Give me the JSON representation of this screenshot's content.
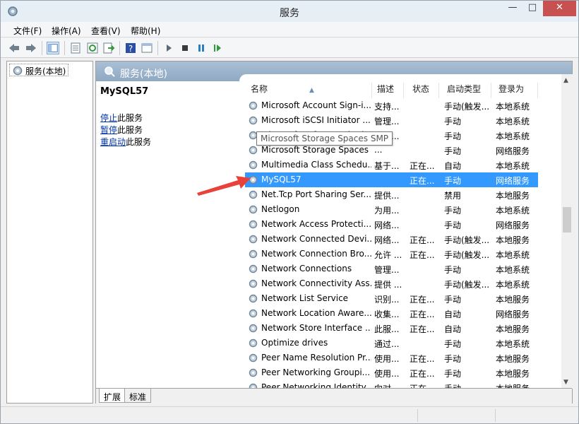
{
  "window": {
    "title": "服务"
  },
  "menu": [
    "文件(F)",
    "操作(A)",
    "查看(V)",
    "帮助(H)"
  ],
  "toolbar": {
    "icons": [
      "back-icon",
      "forward-icon",
      "console-tree-icon",
      "properties-icon",
      "refresh-icon",
      "export-icon",
      "help-icon",
      "view-icon",
      "play-icon",
      "stop-icon",
      "pause-icon",
      "restart-icon"
    ]
  },
  "tree": {
    "root_label": "服务(本地)"
  },
  "pane": {
    "header_title": "服务(本地)",
    "selected_service": "MySQL57",
    "actions": [
      {
        "link": "停止",
        "suffix": "此服务"
      },
      {
        "link": "暂停",
        "suffix": "此服务"
      },
      {
        "link": "重启动",
        "suffix": "此服务"
      }
    ]
  },
  "list": {
    "columns": [
      "名称",
      "描述",
      "状态",
      "启动类型",
      "登录为"
    ],
    "tooltip": "Microsoft Storage Spaces SMP",
    "rows": [
      {
        "name": "Microsoft Account Sign-i...",
        "desc": "支持...",
        "status": "",
        "startup": "手动(触发...",
        "logon": "本地系统"
      },
      {
        "name": "Microsoft iSCSI Initiator ...",
        "desc": "管理...",
        "status": "",
        "startup": "手动",
        "logon": "本地系统"
      },
      {
        "name": "Microsoft Software Shad...",
        "desc": "管理...",
        "status": "",
        "startup": "手动",
        "logon": "本地系统"
      },
      {
        "name": "Microsoft Storage Spaces SMP",
        "desc": "...",
        "status": "",
        "startup": "手动",
        "logon": "网络服务"
      },
      {
        "name": "Multimedia Class Schedu...",
        "desc": "基于...",
        "status": "正在...",
        "startup": "自动",
        "logon": "本地系统"
      },
      {
        "name": "MySQL57",
        "desc": "",
        "status": "正在...",
        "startup": "手动",
        "logon": "网络服务",
        "selected": true
      },
      {
        "name": "Net.Tcp Port Sharing Ser...",
        "desc": "提供...",
        "status": "",
        "startup": "禁用",
        "logon": "本地服务"
      },
      {
        "name": "Netlogon",
        "desc": "为用...",
        "status": "",
        "startup": "手动",
        "logon": "本地系统"
      },
      {
        "name": "Network Access Protecti...",
        "desc": "网络...",
        "status": "",
        "startup": "手动",
        "logon": "网络服务"
      },
      {
        "name": "Network Connected Devi...",
        "desc": "网络...",
        "status": "正在...",
        "startup": "手动(触发...",
        "logon": "本地服务"
      },
      {
        "name": "Network Connection Bro...",
        "desc": "允许 ...",
        "status": "正在...",
        "startup": "手动(触发...",
        "logon": "本地系统"
      },
      {
        "name": "Network Connections",
        "desc": "管理...",
        "status": "",
        "startup": "手动",
        "logon": "本地系统"
      },
      {
        "name": "Network Connectivity Ass...",
        "desc": "提供 ...",
        "status": "",
        "startup": "手动(触发...",
        "logon": "本地系统"
      },
      {
        "name": "Network List Service",
        "desc": "识别...",
        "status": "正在...",
        "startup": "手动",
        "logon": "本地服务"
      },
      {
        "name": "Network Location Aware...",
        "desc": "收集...",
        "status": "正在...",
        "startup": "自动",
        "logon": "网络服务"
      },
      {
        "name": "Network Store Interface ...",
        "desc": "此服...",
        "status": "正在...",
        "startup": "自动",
        "logon": "本地服务"
      },
      {
        "name": "Optimize drives",
        "desc": "通过...",
        "status": "",
        "startup": "手动",
        "logon": "本地系统"
      },
      {
        "name": "Peer Name Resolution Pr...",
        "desc": "使用...",
        "status": "正在...",
        "startup": "手动",
        "logon": "本地服务"
      },
      {
        "name": "Peer Networking Groupi...",
        "desc": "使用...",
        "status": "正在...",
        "startup": "手动",
        "logon": "本地服务"
      },
      {
        "name": "Peer Networking Identity ...",
        "desc": "向对...",
        "status": "正在...",
        "startup": "手动",
        "logon": "本地服务"
      }
    ]
  },
  "tabs": [
    "扩展",
    "标准"
  ],
  "colors": {
    "selection": "#3399ff",
    "header_band": "#a9bfd4",
    "link": "#0033aa",
    "arrow": "#e8423a"
  }
}
